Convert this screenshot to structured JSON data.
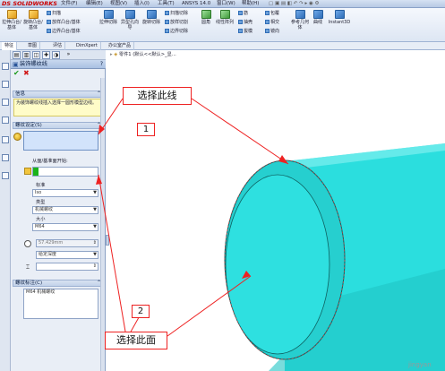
{
  "app": {
    "logo_text": "SOLIDWORKS"
  },
  "menu": {
    "items": [
      "文件(F)",
      "编辑(E)",
      "视图(V)",
      "插入(I)",
      "工具(T)",
      "ANSYS 14.0",
      "窗口(W)",
      "帮助(H)"
    ]
  },
  "ribbon": {
    "large_buttons": [
      "拉伸凸台/基体",
      "旋转凸台/基体",
      "拉伸切除",
      "异型孔向导",
      "旋转切除",
      "圆角",
      "线性阵列",
      "参考几何体",
      "曲线",
      "Instant3D"
    ],
    "small_buttons": [
      "扫描",
      "放样凸台/基体",
      "边界凸台/基体",
      "扫描切除",
      "放样切割",
      "边界切除",
      "筋",
      "抽壳",
      "拔模",
      "包覆",
      "相交",
      "镜向"
    ]
  },
  "tabs": {
    "items": [
      "特征",
      "草图",
      "评估",
      "DimXpert",
      "办公室产品"
    ]
  },
  "pm": {
    "title": "装饰螺纹线",
    "help": "?",
    "info_header": "信息",
    "info_text": "为装饰螺纹线插入选择一圆形模型边线。",
    "settings_header": "螺纹设定(S)",
    "start_label": "从面/基准面开始:",
    "standard_label": "标准",
    "standard_value": "Iso",
    "type_label": "类型",
    "type_value": "机械螺纹",
    "size_label": "大小",
    "size_value": "M64",
    "diameter_value": "57.429mm",
    "end_condition_value": "给定深度",
    "depth_value": "",
    "label_header": "螺纹标注(C)",
    "label_value": "M64 机械螺纹"
  },
  "tree": {
    "root": "零件1 (默认<<默认>_显..."
  },
  "callouts": {
    "select_edge": "选择此线",
    "select_face": "选择此面",
    "num1": "1",
    "num2": "2"
  },
  "watermark": "jingyan",
  "colors": {
    "cylinder": "#2bdede",
    "callout_border": "#ee2222",
    "selection": "#d2e3fb"
  }
}
